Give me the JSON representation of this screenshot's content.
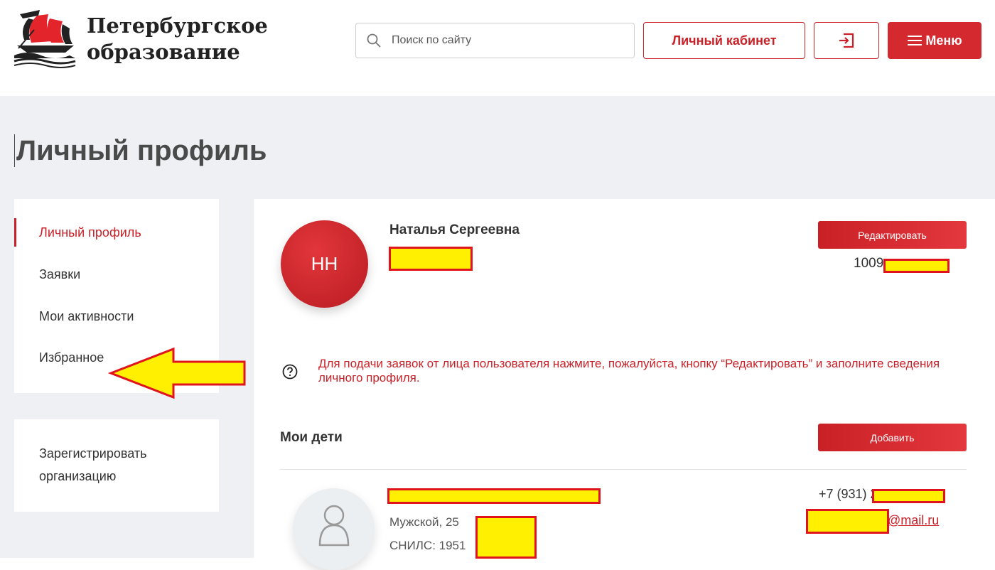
{
  "header": {
    "logo_line1": "Петербургское",
    "logo_line2": "образование",
    "search_placeholder": "Поиск по сайту",
    "cabinet_label": "Личный кабинет",
    "login_icon": "login-icon",
    "menu_label": "Меню",
    "menu_icon": "hamburger-icon"
  },
  "page_title": "Личный профиль",
  "nav": {
    "items": [
      {
        "label": "Личный профиль",
        "active": true
      },
      {
        "label": "Заявки",
        "active": false
      },
      {
        "label": "Мои активности",
        "active": false
      },
      {
        "label": "Избранное",
        "active": false
      }
    ]
  },
  "org": {
    "label": "Зарегистрировать организацию"
  },
  "profile": {
    "initials": "НН",
    "name": "Наталья Сергеевна",
    "edit_label": "Редактировать",
    "id_prefix": "1009",
    "notice": "Для подачи заявок от лица пользователя нажмите, пожалуйста, кнопку “Редактировать” и заполните сведения личного профиля."
  },
  "children": {
    "title": "Мои дети",
    "add_label": "Добавить",
    "child": {
      "gender_age": "Мужской, 25",
      "snils": "СНИЛС: 1951",
      "phone": "+7 (931) 26",
      "email": "@mail.ru"
    }
  },
  "colors": {
    "accent": "#c82128",
    "page_bg": "#eef0f4",
    "redaction_fill": "#ffef00",
    "redaction_border": "#e0141c"
  }
}
